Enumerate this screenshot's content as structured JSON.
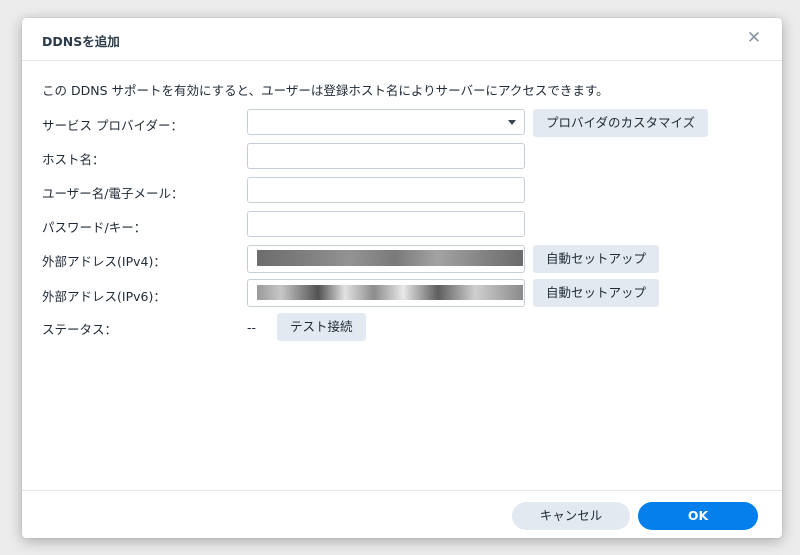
{
  "dialog": {
    "title": "DDNSを追加",
    "close_icon": "close-icon",
    "description": "この DDNS サポートを有効にすると、ユーザーは登録ホスト名によりサーバーにアクセスできます。"
  },
  "form": {
    "provider_label": "サービス プロバイダー：",
    "provider_value": "",
    "customize_button": "プロバイダのカスタマイズ",
    "hostname_label": "ホスト名：",
    "hostname_value": "",
    "username_label": "ユーザー名/電子メール：",
    "username_value": "",
    "password_label": "パスワード/キー：",
    "password_value": "",
    "ipv4_label": "外部アドレス(IPv4)：",
    "ipv6_label": "外部アドレス(IPv6)：",
    "auto_setup_button": "自動セットアップ",
    "status_label": "ステータス：",
    "status_value": "--",
    "test_button": "テスト接続"
  },
  "footer": {
    "cancel": "キャンセル",
    "ok": "OK"
  },
  "colors": {
    "primary": "#057feb",
    "secondary_button": "#e3e9f0",
    "text": "#1f2a36"
  }
}
